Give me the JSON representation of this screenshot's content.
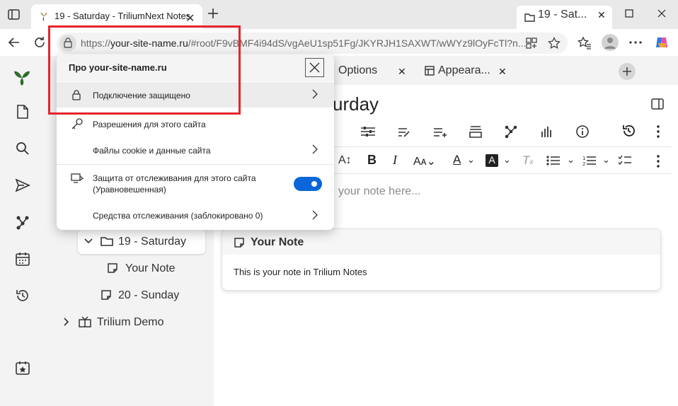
{
  "browser": {
    "tab_title": "19 - Saturday - TriliumNext Notes",
    "tab_close": "✕",
    "url_host": "your-site-name.ru",
    "url_prefix": "https://",
    "url_rest": "/#root/F9vBMF4i94dS/vgAeU1sp51Fg/JKYRJH1SAXWT/wWYz9lOyFcTl?n..."
  },
  "popup": {
    "title": "Про your-site-name.ru",
    "connection": "Подключение защищено",
    "permissions": "Разрешения для этого сайта",
    "cookies": "Файлы cookie и данные сайта",
    "tracking_line1": "Защита от отслеживания для этого сайта",
    "tracking_line2": "(Уравновешенная)",
    "tracking_toggle_on": true,
    "trackers": "Средства отслеживания (заблокировано 0)"
  },
  "trilium": {
    "tabs": [
      "Options",
      "Appeara...",
      "19 - Sat..."
    ],
    "note_title": "urday",
    "placeholder": "your note here...",
    "tree": {
      "item_saturday": "19 - Saturday",
      "item_your_note": "Your Note",
      "item_sunday": "20 - Sunday",
      "item_demo": "Trilium Demo"
    },
    "card": {
      "title": "Your Note",
      "body": "This is your note in Trilium Notes"
    }
  },
  "colors": {
    "accent": "#0a66d9",
    "highlight": "#e5242b",
    "brand": "#2d6b2a"
  }
}
